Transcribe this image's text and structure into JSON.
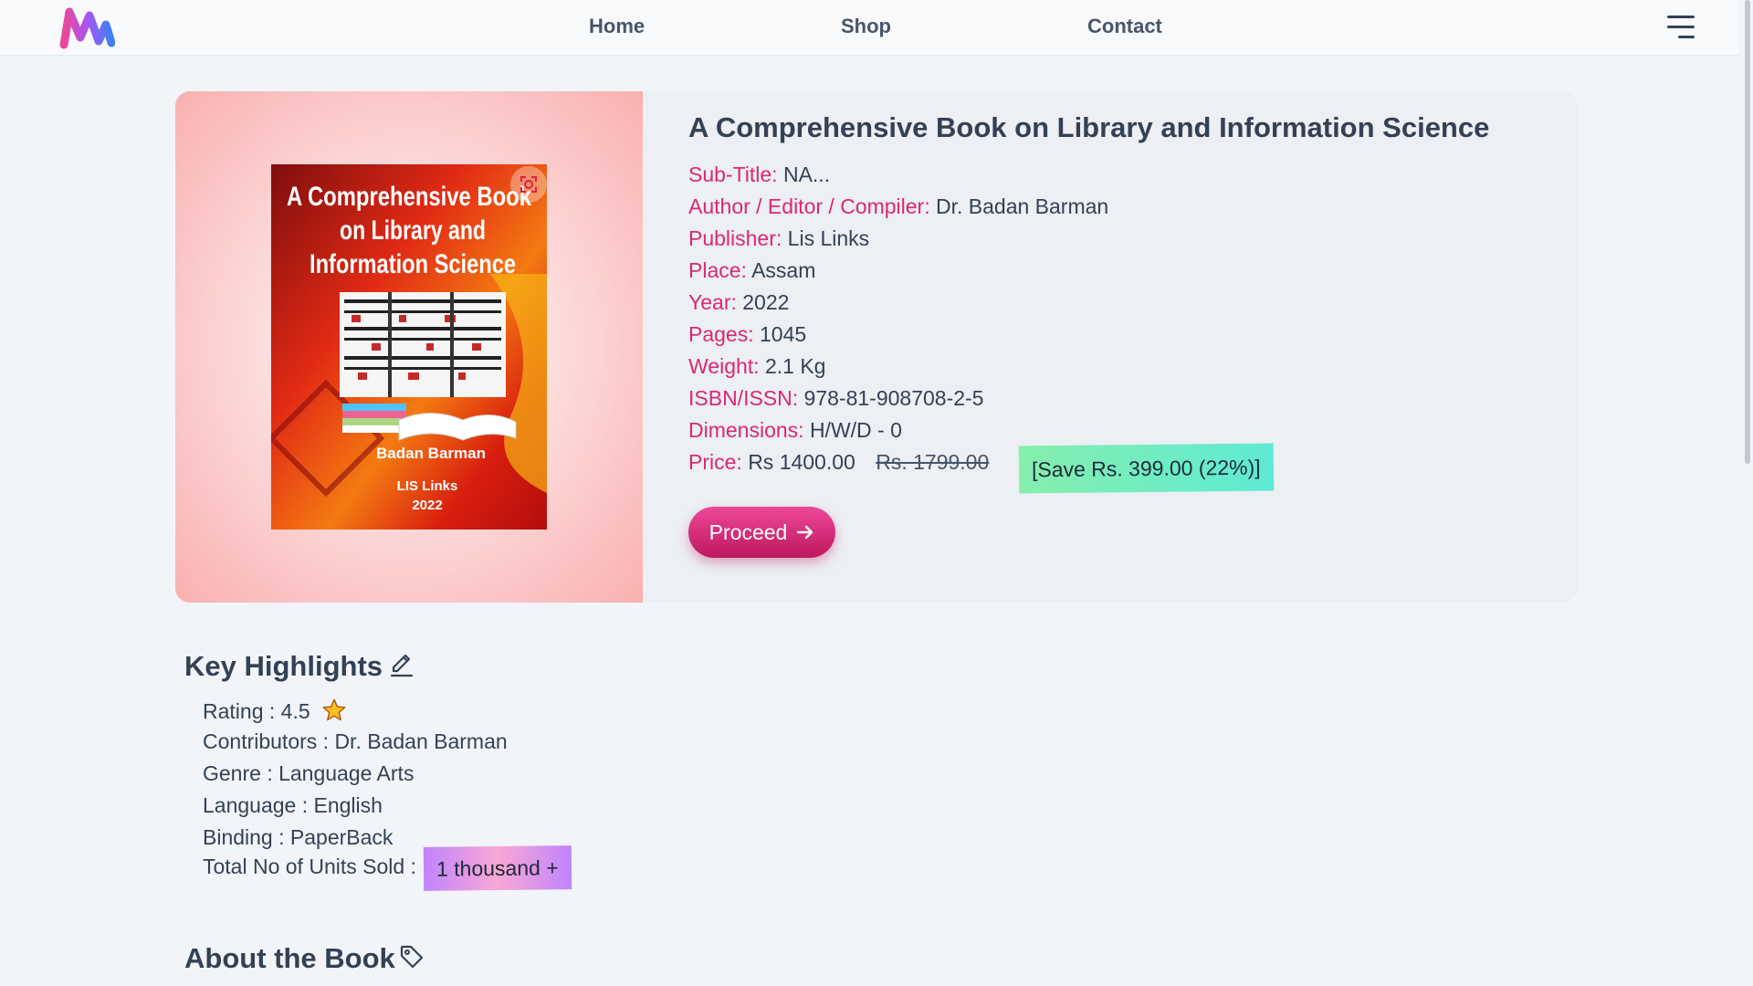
{
  "navbar": {
    "links": [
      "Home",
      "Shop",
      "Contact"
    ],
    "logo_icon": "brand-logo-icon",
    "menu_icon": "hamburger-menu-icon"
  },
  "book": {
    "title": "A Comprehensive Book on Library and Information Science",
    "cover": {
      "title_lines": [
        "A Comprehensive Book",
        "on Library and",
        "Information Science"
      ],
      "author": "Badan Barman",
      "publisher": "LIS Links",
      "year": "2022"
    },
    "details": [
      {
        "label": "Sub-Title:",
        "value": "NA..."
      },
      {
        "label": "Author / Editor / Compiler:",
        "value": "Dr. Badan Barman"
      },
      {
        "label": "Publisher:",
        "value": "Lis Links"
      },
      {
        "label": "Place:",
        "value": "Assam"
      },
      {
        "label": "Year:",
        "value": "2022"
      },
      {
        "label": "Pages:",
        "value": "1045"
      },
      {
        "label": "Weight:",
        "value": "2.1 Kg"
      },
      {
        "label": "ISBN/ISSN:",
        "value": "978-81-908708-2-5"
      },
      {
        "label": "Dimensions:",
        "value": "H/W/D - 0"
      }
    ],
    "price": {
      "label": "Price:",
      "current": "Rs 1400.00",
      "original": "Rs. 1799.00",
      "save": "[Save Rs. 399.00 (22%)]"
    },
    "proceed_label": "Proceed",
    "proceed_icon": "arrow-right-icon"
  },
  "highlights": {
    "title": "Key Highlights",
    "rating_label": "Rating :",
    "rating_value": "4.5",
    "contributors": "Contributors : Dr. Badan Barman",
    "genre": "Genre : Language Arts",
    "language": "Language : English",
    "binding": "Binding : PaperBack",
    "units_label": "Total No of Units Sold :",
    "units_value": "1 thousand +"
  },
  "about": {
    "title": "About the Book"
  },
  "colors": {
    "accent": "#db2777",
    "text": "#334155",
    "save_badge": "#86efac",
    "units_badge": "#c084fc"
  }
}
